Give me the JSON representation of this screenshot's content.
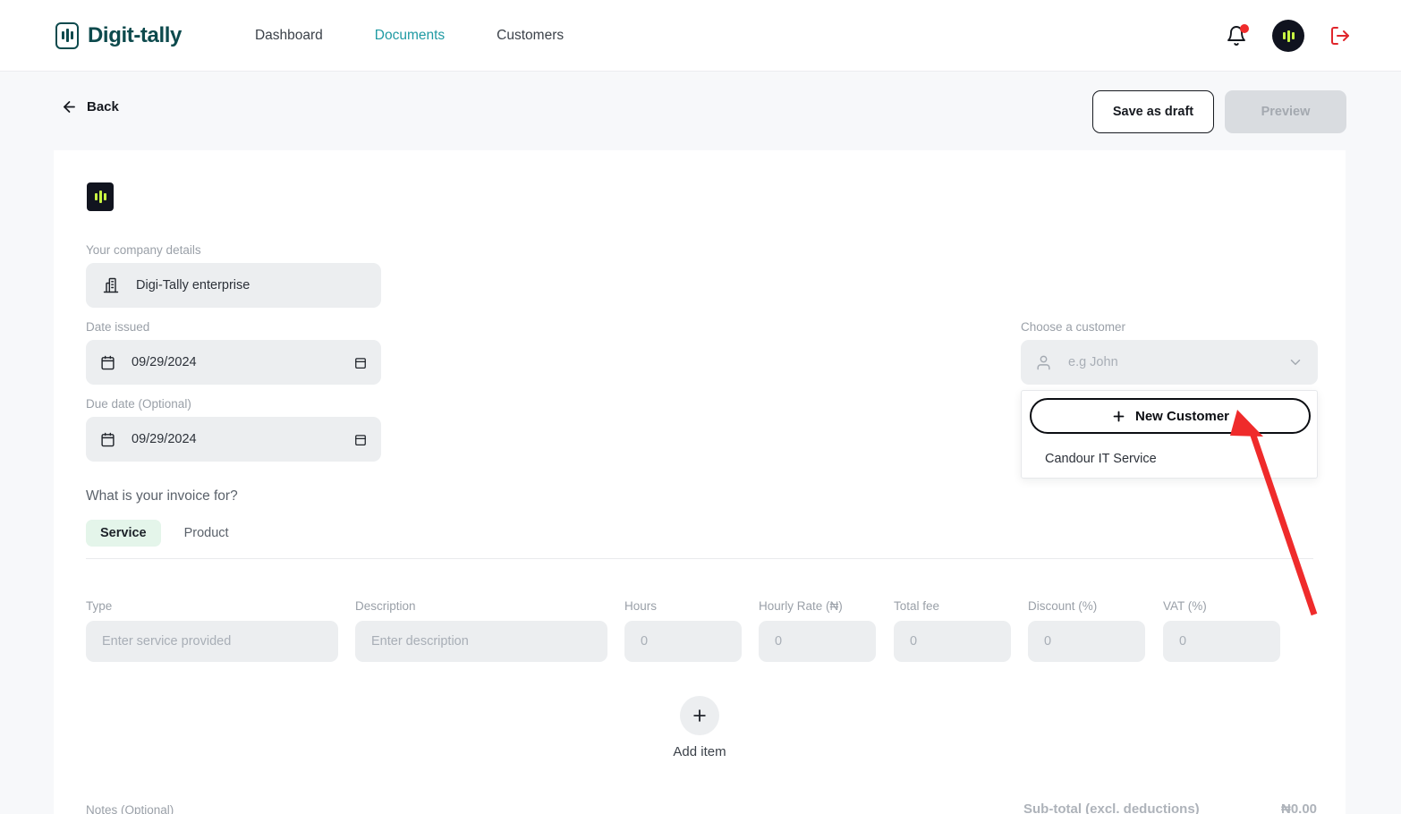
{
  "navbar": {
    "brand": "Digit-tally",
    "brand_icon": "digit-tally-logo-icon",
    "links": [
      {
        "label": "Dashboard",
        "active": false
      },
      {
        "label": "Documents",
        "active": true
      },
      {
        "label": "Customers",
        "active": false
      }
    ],
    "notifications_icon": "bell-icon",
    "avatar_icon": "user-avatar",
    "logout_icon": "logout-icon",
    "active_link_color": "#1f9aa3",
    "brand_color": "#0d4a4d"
  },
  "subheader": {
    "back_label": "Back",
    "back_icon": "arrow-left-icon",
    "save_draft_label": "Save as draft",
    "preview_label": "Preview",
    "preview_disabled": true
  },
  "form": {
    "document_logo_icon": "digit-tally-square-logo",
    "company": {
      "label": "Your company details",
      "value": "Digi-Tally enterprise",
      "icon": "building-icon"
    },
    "date_issued": {
      "label": "Date issued",
      "value": "09/29/2024",
      "icon": "calendar-icon"
    },
    "due_date": {
      "label": "Due date (Optional)",
      "value": "09/29/2024",
      "icon": "calendar-icon"
    },
    "customer": {
      "label": "Choose a customer",
      "placeholder": "e.g John",
      "value": "",
      "icon": "person-icon",
      "chevron_icon": "chevron-down-icon",
      "dropdown_open": true,
      "new_customer_label": "New Customer",
      "new_customer_icon": "plus-icon",
      "options": [
        "Candour IT Service"
      ]
    },
    "invoice_for": {
      "question": "What is your invoice for?",
      "options": [
        {
          "label": "Service",
          "selected": true
        },
        {
          "label": "Product",
          "selected": false
        }
      ],
      "selected_bg": "#e4f5ea"
    }
  },
  "line_items": {
    "columns": [
      {
        "header": "Type",
        "placeholder": "Enter service provided"
      },
      {
        "header": "Description",
        "placeholder": "Enter description"
      },
      {
        "header": "Hours",
        "placeholder": "0"
      },
      {
        "header": "Hourly Rate (₦)",
        "placeholder": "0"
      },
      {
        "header": "Total fee",
        "placeholder": "0"
      },
      {
        "header": "Discount (%)",
        "placeholder": "0"
      },
      {
        "header": "VAT (%)",
        "placeholder": "0"
      }
    ],
    "add_item_label": "Add item",
    "add_item_icon": "plus-icon"
  },
  "footer": {
    "notes_label": "Notes (Optional)",
    "subtotal_label": "Sub-total (excl. deductions)",
    "subtotal_value": "₦0.00"
  },
  "annotation": {
    "arrow_color": "#ef2b2b",
    "points_to": "New Customer"
  }
}
